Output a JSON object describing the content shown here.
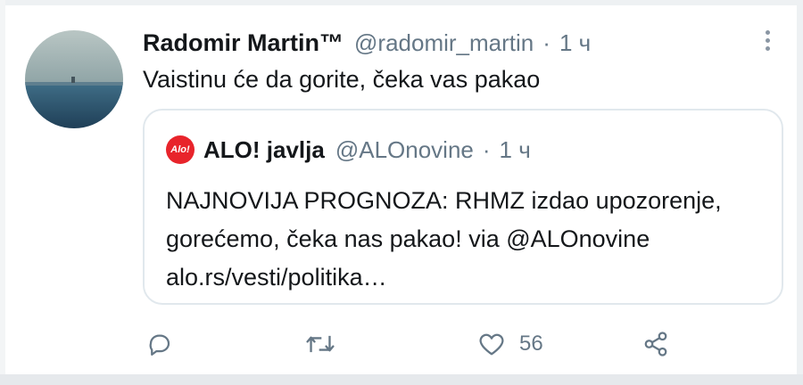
{
  "tweet": {
    "author_name": "Radomir Martin™",
    "handle": "@radomir_martin",
    "separator": "·",
    "time": "1 ч",
    "text": "Vaistinu će da gorite, čeka vas pakao"
  },
  "quoted": {
    "logo_text": "Alo!",
    "author_name": "ALO! javlja",
    "handle": "@ALOnovine",
    "separator": "·",
    "time": "1 ч",
    "text": "NAJNOVIJA PROGNOZA: RHMZ izdao upozorenje, gorećemo, čeka nas pakao! via @ALOnovine alo.rs/vesti/politika…"
  },
  "actions": {
    "icons": [
      "reply-icon",
      "retweet-icon",
      "like-icon",
      "share-icon"
    ],
    "like_count": "56"
  },
  "colors": {
    "text": "#14171a",
    "secondary": "#657786",
    "border": "#e1e8ed",
    "alo_red": "#e8242b"
  }
}
